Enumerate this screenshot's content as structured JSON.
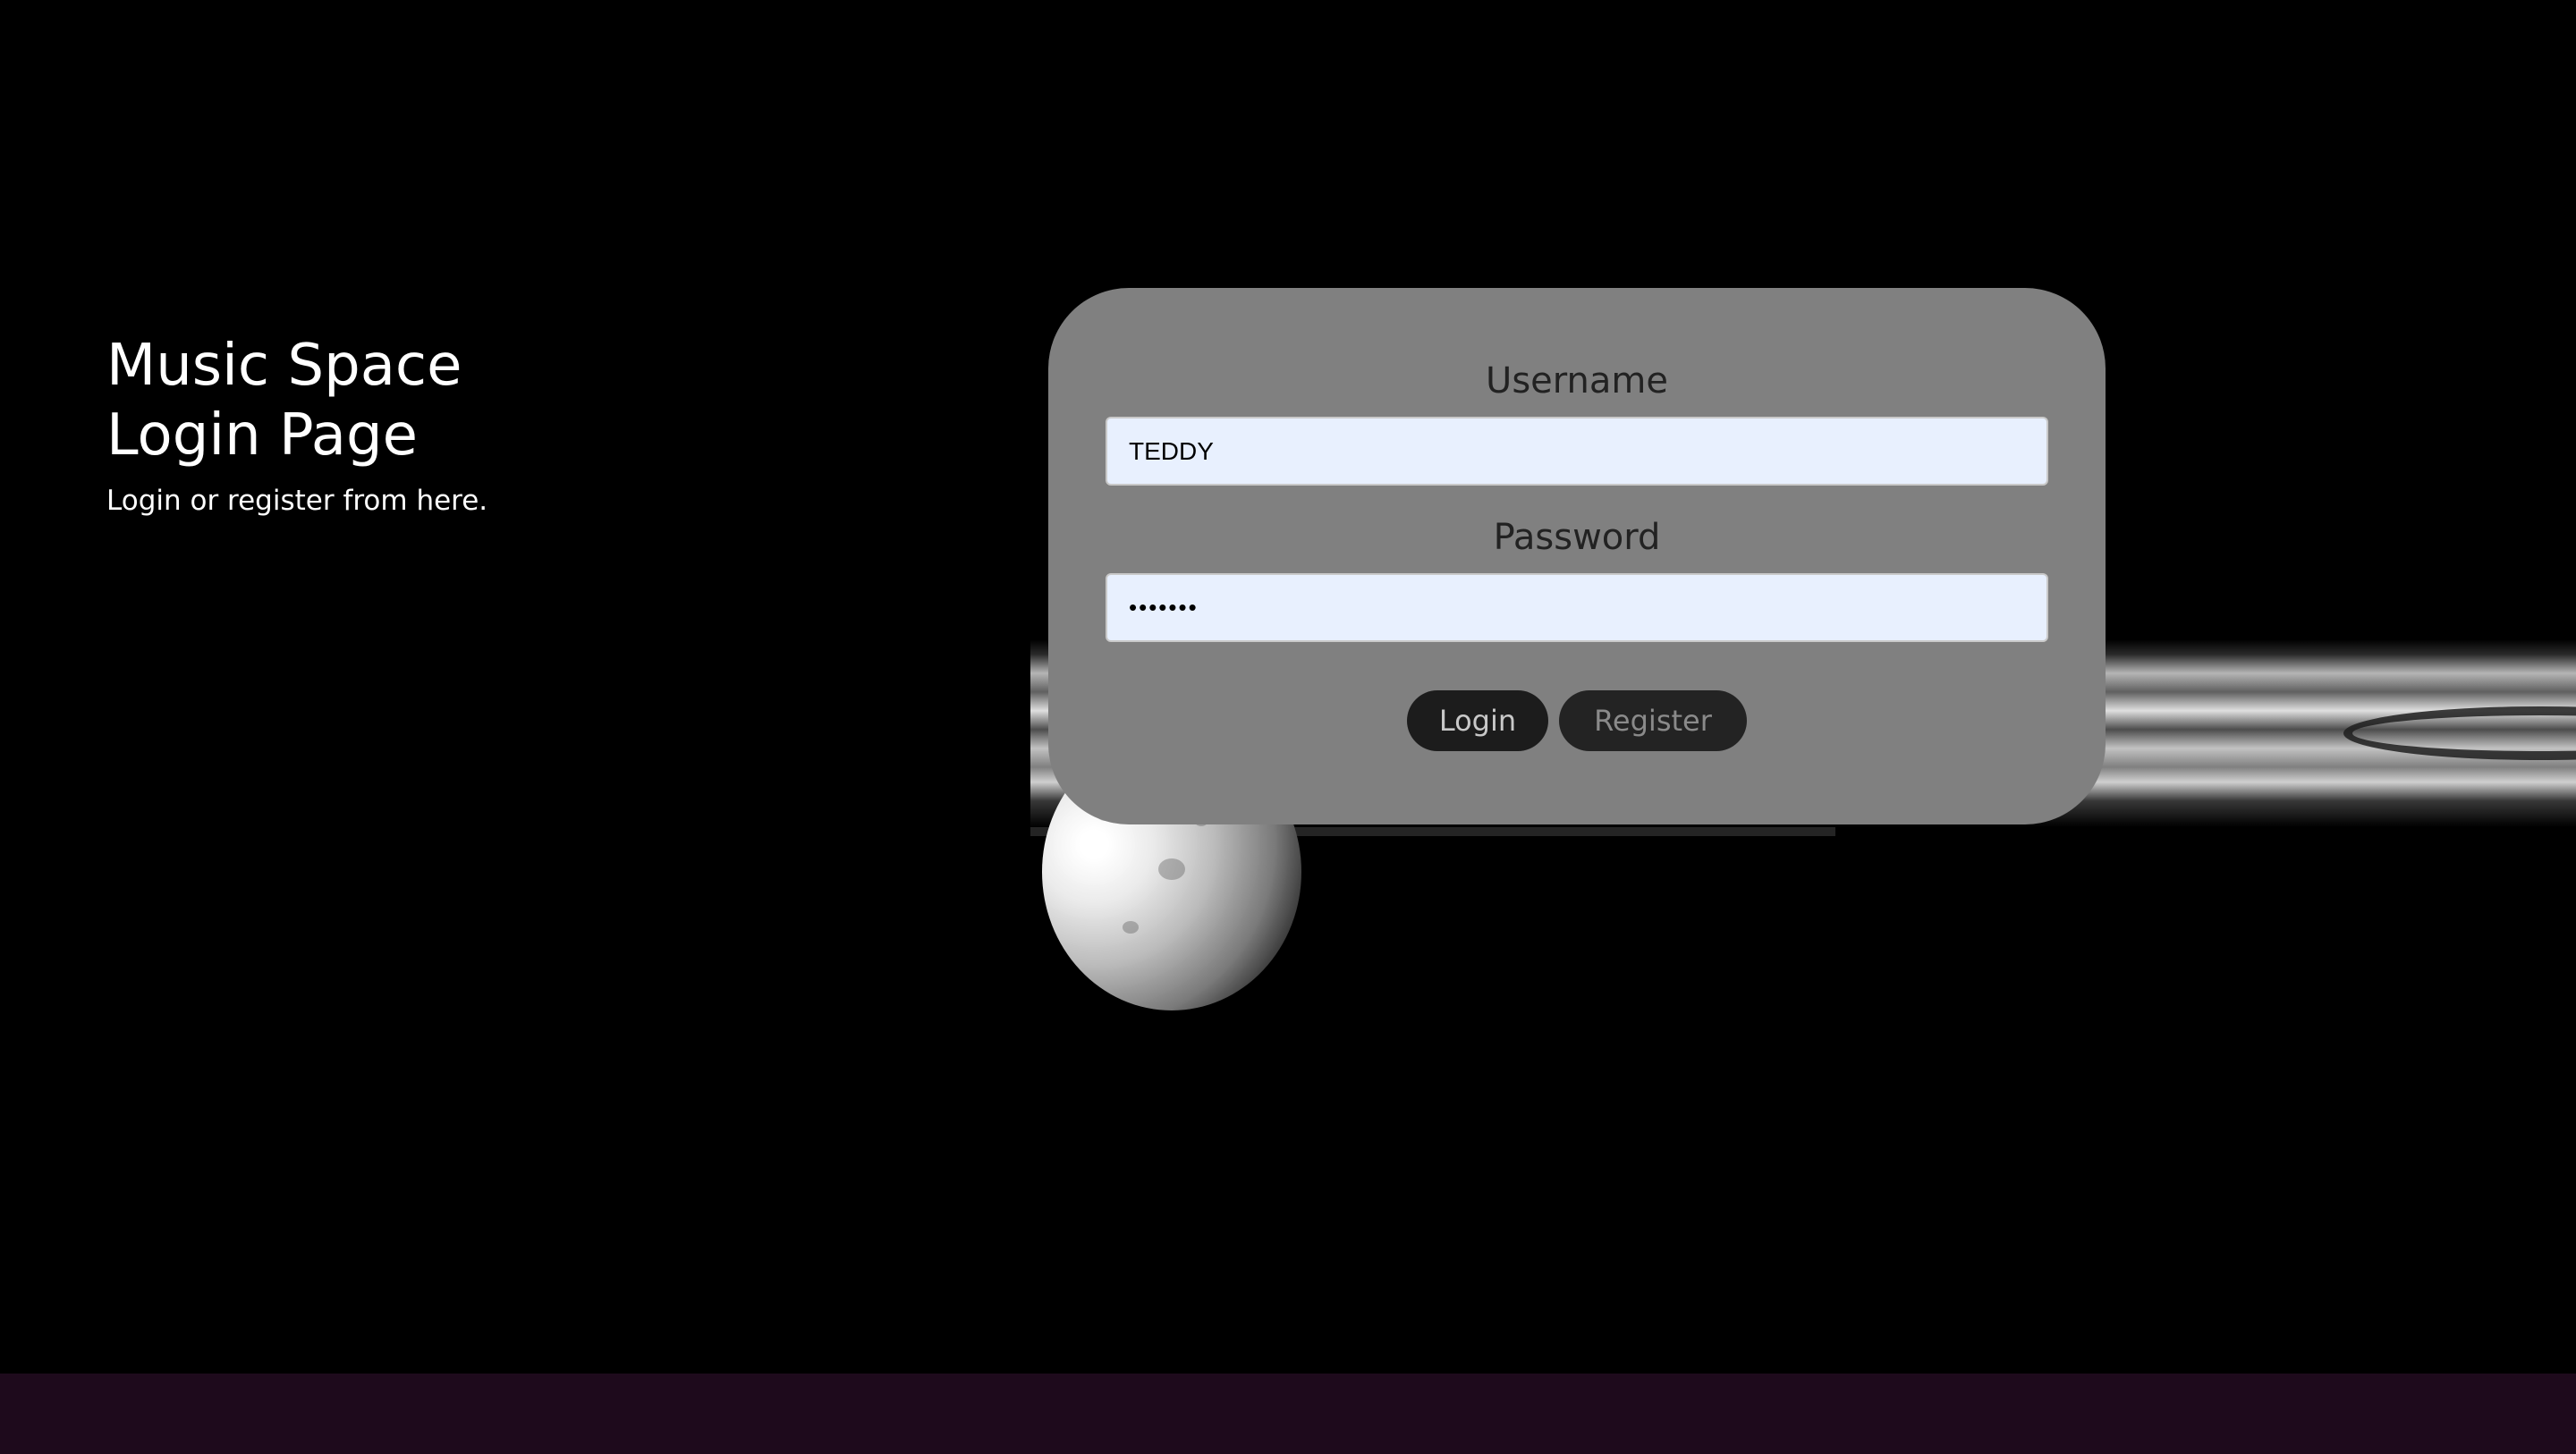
{
  "intro": {
    "title_line1": "Music Space",
    "title_line2": "Login Page",
    "subtitle": "Login or register from here."
  },
  "login_form": {
    "username_label": "Username",
    "username_value": "TEDDY",
    "password_label": "Password",
    "password_value": "•••••••",
    "login_button": "Login",
    "register_button": "Register"
  },
  "colors": {
    "background": "#000000",
    "card": "#808080",
    "input_bg": "#e8f0fe",
    "button_dark": "#1c1c1c",
    "footer": "#1e0a1c"
  }
}
